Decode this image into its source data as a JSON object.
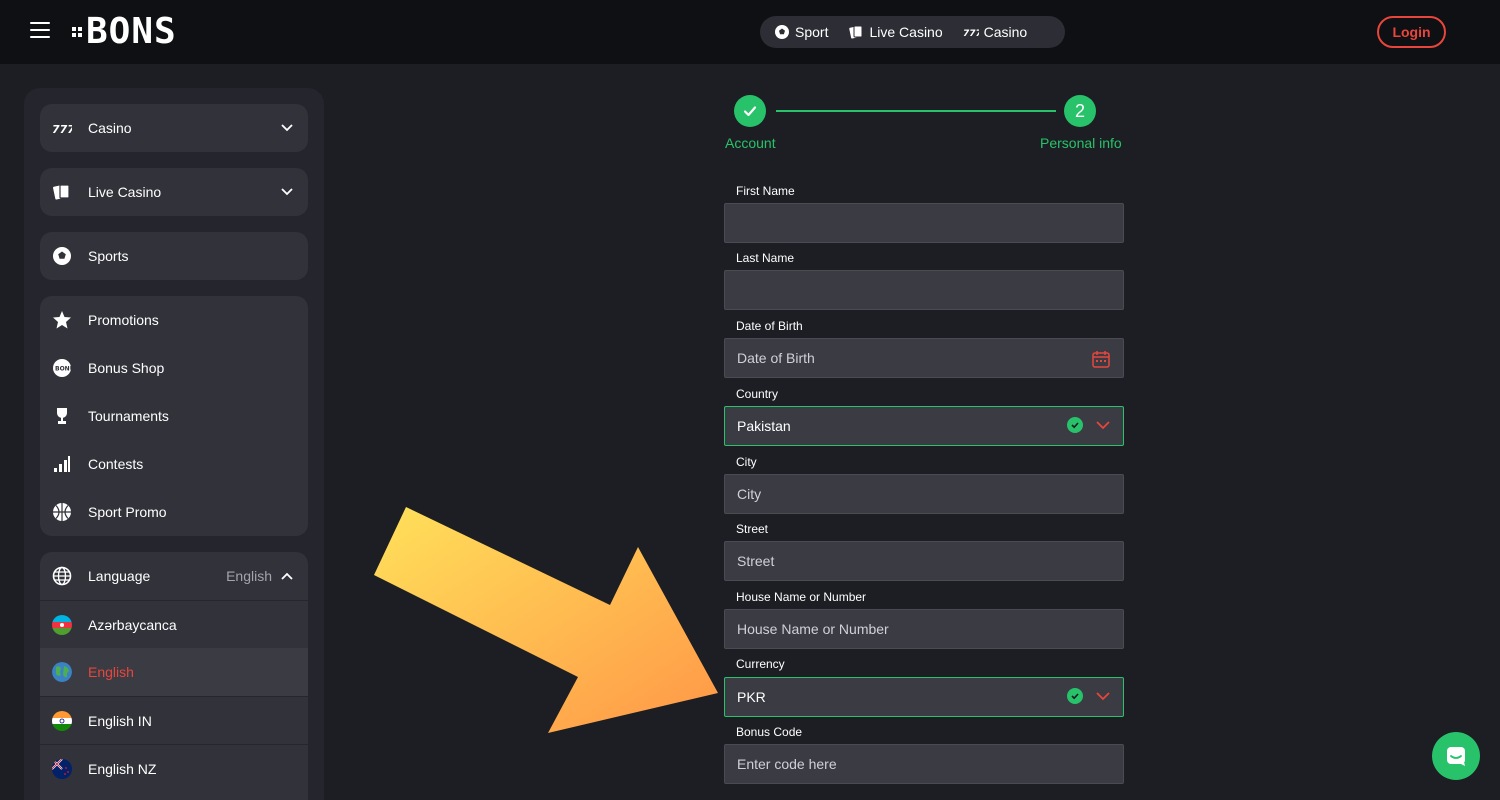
{
  "header": {
    "logo_text": "BONS",
    "nav": [
      {
        "label": "Sport",
        "icon": "soccer-ball-icon"
      },
      {
        "label": "Live Casino",
        "icon": "cards-icon"
      },
      {
        "label": "Casino",
        "icon": "slot-777-icon"
      }
    ],
    "login_label": "Login"
  },
  "sidebar": {
    "sections": {
      "casino": {
        "label": "Casino"
      },
      "live_casino": {
        "label": "Live Casino"
      },
      "sports": {
        "label": "Sports"
      }
    },
    "promo_items": [
      {
        "label": "Promotions"
      },
      {
        "label": "Bonus Shop"
      },
      {
        "label": "Tournaments"
      },
      {
        "label": "Contests"
      },
      {
        "label": "Sport Promo"
      }
    ],
    "language": {
      "label": "Language",
      "value": "English",
      "options": [
        {
          "label": "Azərbaycanca"
        },
        {
          "label": "English"
        },
        {
          "label": "English IN"
        },
        {
          "label": "English NZ"
        }
      ]
    }
  },
  "stepper": {
    "step1_label": "Account",
    "step2_number": "2",
    "step2_label": "Personal info"
  },
  "form": {
    "first_name": {
      "label": "First Name",
      "value": ""
    },
    "last_name": {
      "label": "Last Name",
      "value": ""
    },
    "dob": {
      "label": "Date of Birth",
      "placeholder": "Date of Birth"
    },
    "country": {
      "label": "Country",
      "value": "Pakistan"
    },
    "city": {
      "label": "City",
      "placeholder": "City"
    },
    "street": {
      "label": "Street",
      "placeholder": "Street"
    },
    "house": {
      "label": "House Name or Number",
      "placeholder": "House Name or Number"
    },
    "currency": {
      "label": "Currency",
      "value": "PKR"
    },
    "bonus": {
      "label": "Bonus Code",
      "placeholder": "Enter code here"
    }
  },
  "colors": {
    "accent_red": "#e8463d",
    "success_green": "#27c26a",
    "background": "#1d1e23",
    "header_bg": "#0f1013"
  }
}
